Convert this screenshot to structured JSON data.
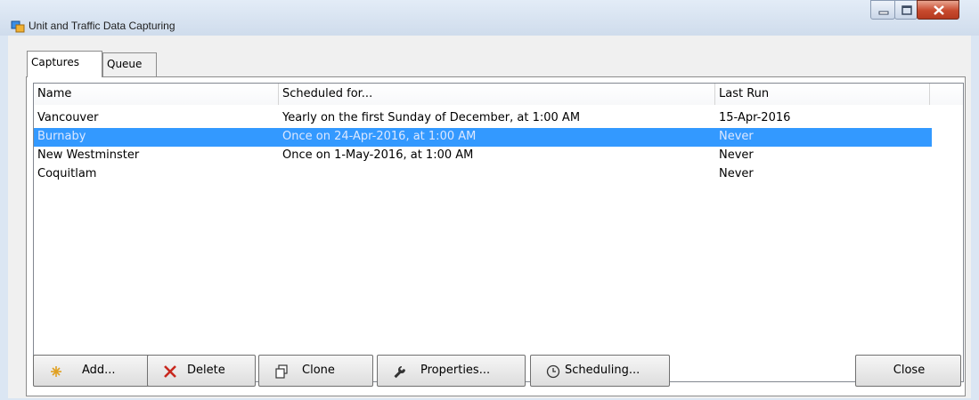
{
  "window": {
    "title": "Unit and Traffic Data Capturing"
  },
  "tabs": [
    {
      "label": "Captures",
      "active": true
    },
    {
      "label": "Queue",
      "active": false
    }
  ],
  "list": {
    "columns": [
      "Name",
      "Scheduled for...",
      "Last Run",
      ""
    ],
    "rows": [
      {
        "name": "Vancouver",
        "scheduled": "Yearly on the first Sunday of December, at 1:00 AM",
        "last_run": "15-Apr-2016",
        "selected": false
      },
      {
        "name": "Burnaby",
        "scheduled": "Once on 24-Apr-2016, at 1:00 AM",
        "last_run": "Never",
        "selected": true
      },
      {
        "name": "New Westminster",
        "scheduled": "Once on 1-May-2016, at 1:00 AM",
        "last_run": "Never",
        "selected": false
      },
      {
        "name": "Coquitlam",
        "scheduled": "",
        "last_run": "Never",
        "selected": false
      }
    ]
  },
  "buttons": {
    "add": {
      "label": "Add...",
      "icon": "star-burst-icon"
    },
    "delete": {
      "label": "Delete",
      "icon": "red-x-icon"
    },
    "clone": {
      "label": "Clone",
      "icon": "copy-icon"
    },
    "properties": {
      "label": "Properties...",
      "icon": "wrench-icon"
    },
    "scheduling": {
      "label": "Scheduling...",
      "icon": "clock-icon"
    },
    "close": {
      "label": "Close"
    }
  },
  "colors": {
    "selection": "#3399ff",
    "delete_icon": "#c8281e",
    "add_icon": "#e0a020"
  }
}
